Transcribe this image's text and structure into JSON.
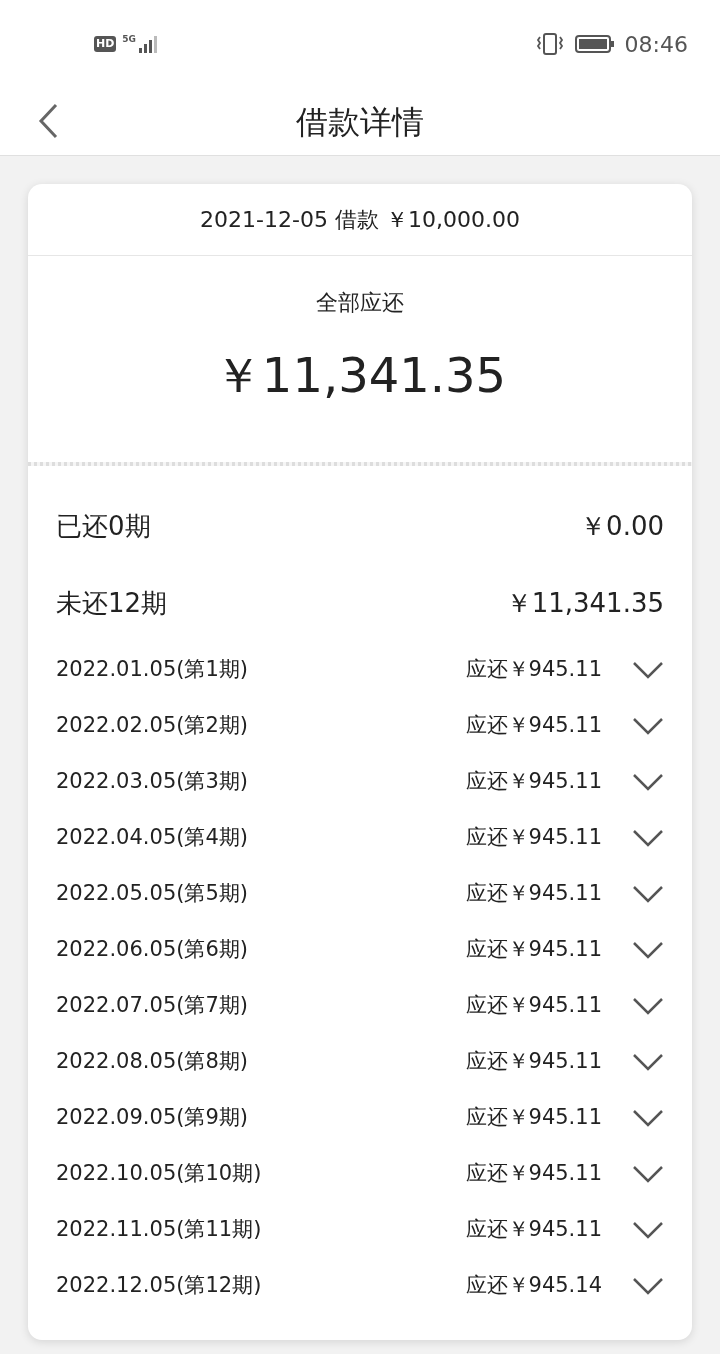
{
  "status_bar": {
    "hd_badge": "HD",
    "network": "5G",
    "time": "08:46"
  },
  "header": {
    "title": "借款详情"
  },
  "loan": {
    "summary": "2021-12-05 借款 ￥10,000.00",
    "total_label": "全部应还",
    "total_amount": "￥11,341.35"
  },
  "totals": [
    {
      "label": "已还0期",
      "amount": "￥0.00"
    },
    {
      "label": "未还12期",
      "amount": "￥11,341.35"
    }
  ],
  "installments": [
    {
      "date": "2022.01.05(第1期)",
      "amount": "应还￥945.11",
      "expanded": false
    },
    {
      "date": "2022.02.05(第2期)",
      "amount": "应还￥945.11",
      "expanded": false
    },
    {
      "date": "2022.03.05(第3期)",
      "amount": "应还￥945.11",
      "expanded": false
    },
    {
      "date": "2022.04.05(第4期)",
      "amount": "应还￥945.11",
      "expanded": false
    },
    {
      "date": "2022.05.05(第5期)",
      "amount": "应还￥945.11",
      "expanded": false
    },
    {
      "date": "2022.06.05(第6期)",
      "amount": "应还￥945.11",
      "expanded": false
    },
    {
      "date": "2022.07.05(第7期)",
      "amount": "应还￥945.11",
      "expanded": false
    },
    {
      "date": "2022.08.05(第8期)",
      "amount": "应还￥945.11",
      "expanded": false
    },
    {
      "date": "2022.09.05(第9期)",
      "amount": "应还￥945.11",
      "expanded": false
    },
    {
      "date": "2022.10.05(第10期)",
      "amount": "应还￥945.11",
      "expanded": false
    },
    {
      "date": "2022.11.05(第11期)",
      "amount": "应还￥945.11",
      "expanded": false
    },
    {
      "date": "2022.12.05(第12期)",
      "amount": "应还￥945.14",
      "expanded": false
    }
  ]
}
